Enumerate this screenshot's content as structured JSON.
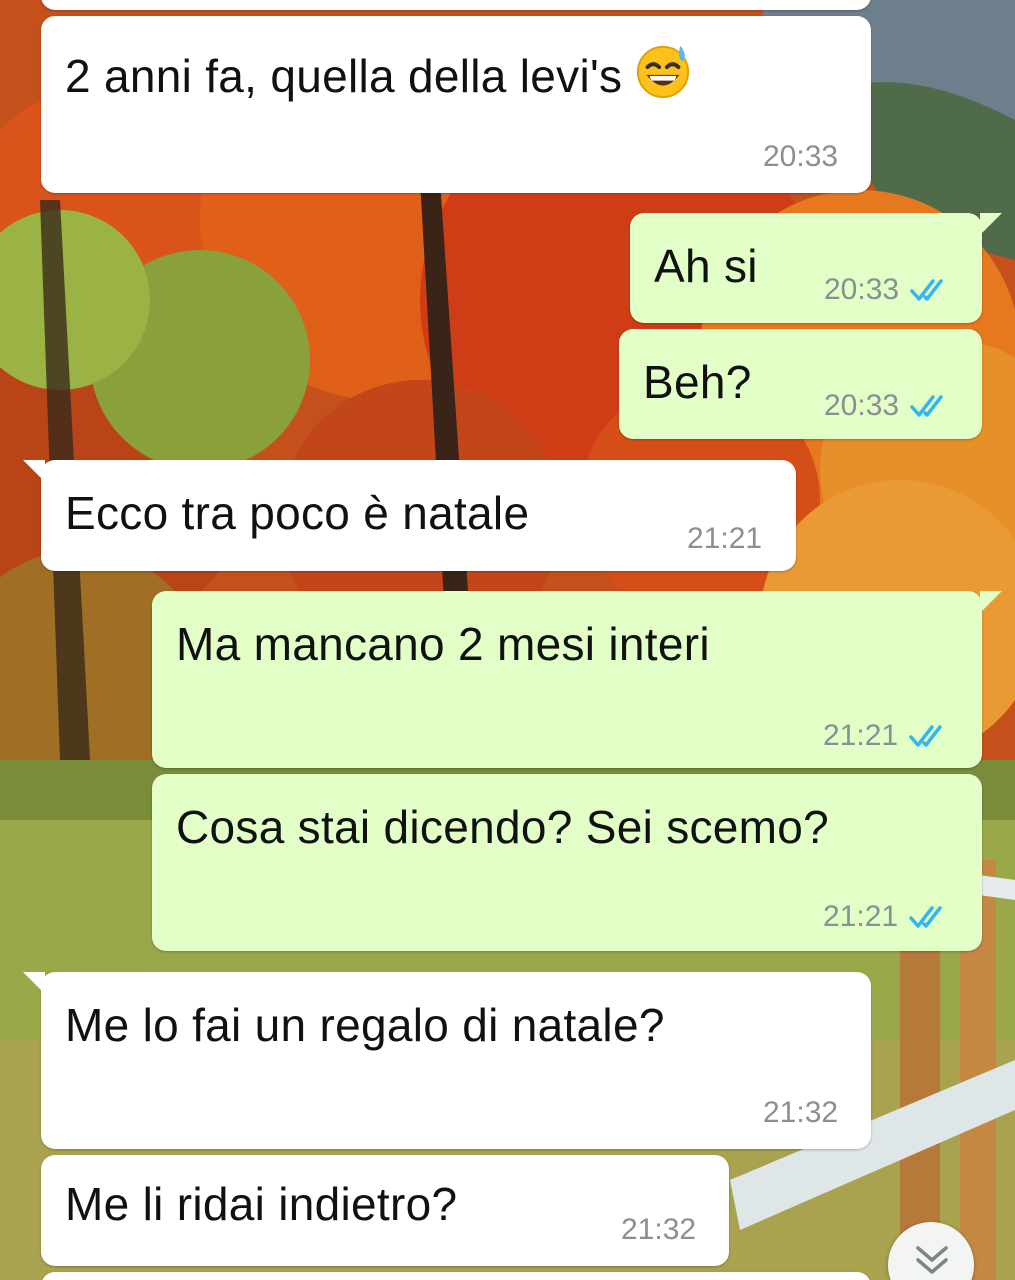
{
  "colors": {
    "incoming_bubble": "#ffffff",
    "outgoing_bubble": "#e2ffc7",
    "timestamp": "#8a8f93",
    "read_ticks": "#34b7f1"
  },
  "messages": [
    {
      "direction": "in",
      "text": "2 anni fa, quella della levi's",
      "emoji": "grinning-face-with-sweat",
      "time": "20:33"
    },
    {
      "direction": "out",
      "text": "Ah si",
      "time": "20:33",
      "status": "read"
    },
    {
      "direction": "out",
      "text": "Beh?",
      "time": "20:33",
      "status": "read"
    },
    {
      "direction": "in",
      "text": "Ecco tra poco è natale",
      "time": "21:21"
    },
    {
      "direction": "out",
      "text": "Ma mancano 2 mesi interi",
      "time": "21:21",
      "status": "read"
    },
    {
      "direction": "out",
      "text": "Cosa stai dicendo? Sei scemo?",
      "time": "21:21",
      "status": "read"
    },
    {
      "direction": "in",
      "text": "Me lo fai un regalo di natale?",
      "time": "21:32"
    },
    {
      "direction": "in",
      "text": "Me li ridai indietro?",
      "time": "21:32"
    }
  ],
  "scroll_button": {
    "icon": "double-chevron-down-icon"
  }
}
